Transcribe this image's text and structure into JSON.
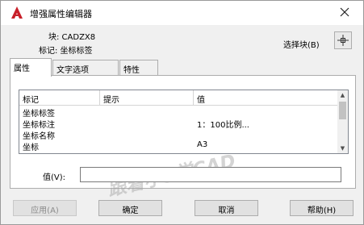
{
  "window": {
    "title": "增强属性编辑器"
  },
  "header": {
    "block_label": "块: CADZX8",
    "tag_label": "标记: 坐标标签",
    "select_block_label": "选择块(B)"
  },
  "tabs": [
    {
      "label": "属性"
    },
    {
      "label": "文字选项"
    },
    {
      "label": "特性"
    }
  ],
  "grid": {
    "columns": [
      "标记",
      "提示",
      "值"
    ],
    "rows": [
      {
        "tag": "坐标标签",
        "prompt": "",
        "value": ""
      },
      {
        "tag": "坐标标注",
        "prompt": "",
        "value": "1：100比例..."
      },
      {
        "tag": "坐标名称",
        "prompt": "",
        "value": ""
      },
      {
        "tag": "坐标",
        "prompt": "",
        "value": "A3"
      }
    ]
  },
  "value_field": {
    "label": "值(V):",
    "value": ""
  },
  "buttons": {
    "apply": "应用(A)",
    "ok": "确定",
    "cancel": "取消",
    "help": "帮助(H)"
  },
  "watermark": "跟着小8学CAD",
  "colors": {
    "logo_red": "#c8202a",
    "thumb": "#c2c2c2"
  }
}
